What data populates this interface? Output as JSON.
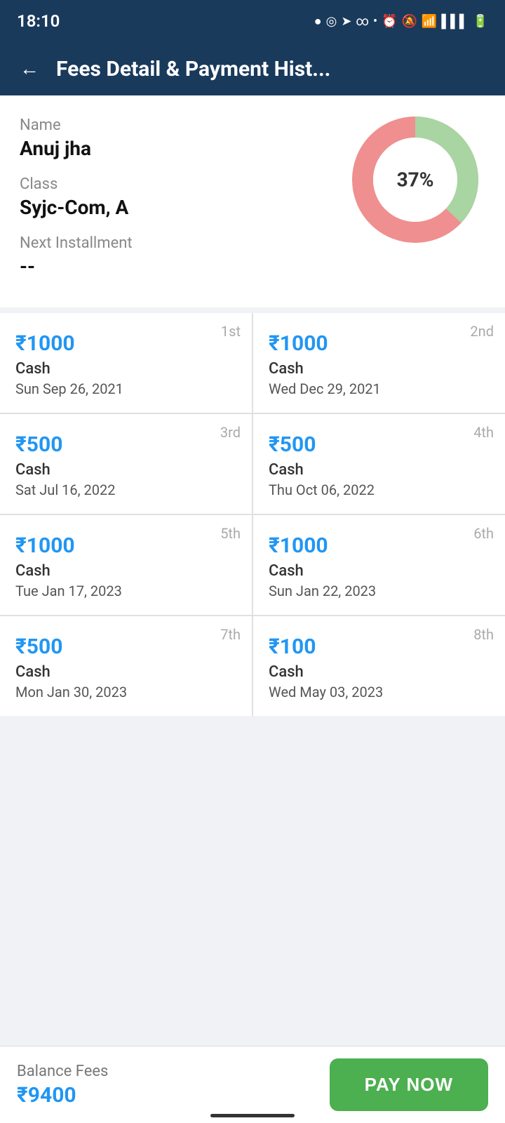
{
  "statusBar": {
    "time": "18:10",
    "icons": "⏰ 🔕 📶 🔋"
  },
  "header": {
    "title": "Fees Detail & Payment Hist...",
    "backLabel": "←"
  },
  "profile": {
    "nameLabel": "Name",
    "nameValue": "Anuj jha",
    "classLabel": "Class",
    "classValue": "Syjc-Com, A",
    "installmentLabel": "Next Installment",
    "installmentValue": "--",
    "chartPercent": "37%",
    "chartPercentNum": 37
  },
  "payments": [
    {
      "installment": "1st",
      "amount": "₹1000",
      "method": "Cash",
      "date": "Sun Sep 26, 2021"
    },
    {
      "installment": "2nd",
      "amount": "₹1000",
      "method": "Cash",
      "date": "Wed Dec 29, 2021"
    },
    {
      "installment": "3rd",
      "amount": "₹500",
      "method": "Cash",
      "date": "Sat Jul 16, 2022"
    },
    {
      "installment": "4th",
      "amount": "₹500",
      "method": "Cash",
      "date": "Thu Oct 06, 2022"
    },
    {
      "installment": "5th",
      "amount": "₹1000",
      "method": "Cash",
      "date": "Tue Jan 17, 2023"
    },
    {
      "installment": "6th",
      "amount": "₹1000",
      "method": "Cash",
      "date": "Sun Jan 22, 2023"
    },
    {
      "installment": "7th",
      "amount": "₹500",
      "method": "Cash",
      "date": "Mon Jan 30, 2023"
    },
    {
      "installment": "8th",
      "amount": "₹100",
      "method": "Cash",
      "date": "Wed May 03, 2023"
    }
  ],
  "bottomBar": {
    "balanceLabel": "Balance Fees",
    "balanceAmount": "₹9400",
    "payNowLabel": "PAY NOW"
  },
  "chart": {
    "paidColor": "#a8d5a2",
    "unpaidColor": "#ef8f8f",
    "bgColor": "#ffffff",
    "innerRadius": 60,
    "outerRadius": 90
  }
}
